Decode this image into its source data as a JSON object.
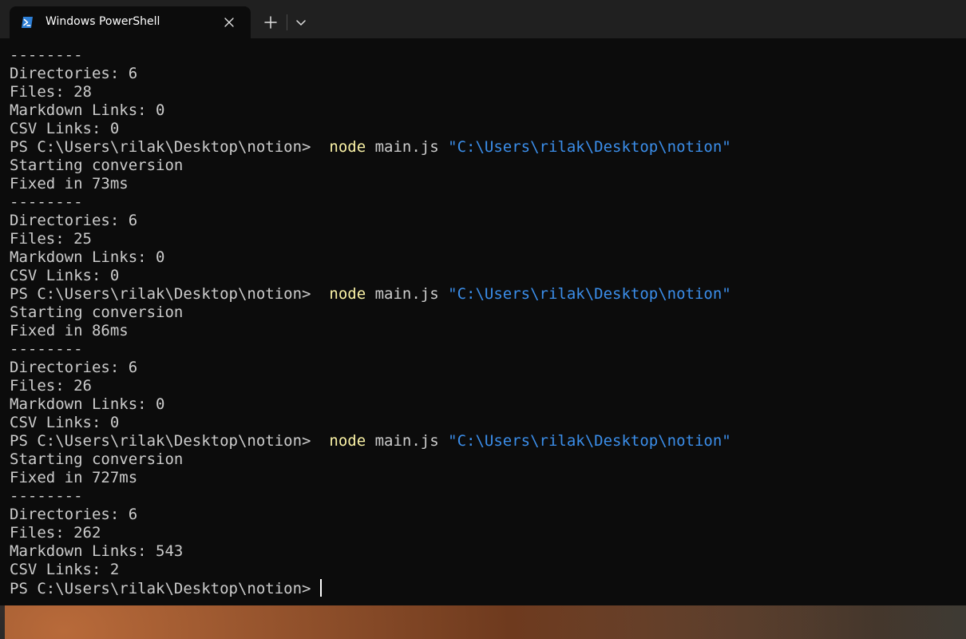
{
  "window": {
    "tab_title": "Windows PowerShell",
    "tab_icon": "powershell-icon",
    "close_icon": "close-icon",
    "new_tab_icon": "plus-icon",
    "dropdown_icon": "chevron-down-icon"
  },
  "terminal": {
    "prompt": "PS C:\\Users\\rilak\\Desktop\\notion>",
    "colors": {
      "background": "#0c0c0c",
      "foreground": "#cccccc",
      "command": "#f9f1a5",
      "string": "#3b8eea"
    },
    "lines": [
      {
        "kind": "text",
        "text": "--------"
      },
      {
        "kind": "text",
        "text": "Directories: 6"
      },
      {
        "kind": "text",
        "text": "Files: 28"
      },
      {
        "kind": "text",
        "text": "Markdown Links: 0"
      },
      {
        "kind": "text",
        "text": "CSV Links: 0"
      },
      {
        "kind": "command",
        "prompt": "PS C:\\Users\\rilak\\Desktop\\notion>",
        "cmd": "node",
        "args": "main.js",
        "str": "\"C:\\Users\\rilak\\Desktop\\notion\""
      },
      {
        "kind": "text",
        "text": "Starting conversion"
      },
      {
        "kind": "text",
        "text": "Fixed in 73ms"
      },
      {
        "kind": "text",
        "text": "--------"
      },
      {
        "kind": "text",
        "text": "Directories: 6"
      },
      {
        "kind": "text",
        "text": "Files: 25"
      },
      {
        "kind": "text",
        "text": "Markdown Links: 0"
      },
      {
        "kind": "text",
        "text": "CSV Links: 0"
      },
      {
        "kind": "command",
        "prompt": "PS C:\\Users\\rilak\\Desktop\\notion>",
        "cmd": "node",
        "args": "main.js",
        "str": "\"C:\\Users\\rilak\\Desktop\\notion\""
      },
      {
        "kind": "text",
        "text": "Starting conversion"
      },
      {
        "kind": "text",
        "text": "Fixed in 86ms"
      },
      {
        "kind": "text",
        "text": "--------"
      },
      {
        "kind": "text",
        "text": "Directories: 6"
      },
      {
        "kind": "text",
        "text": "Files: 26"
      },
      {
        "kind": "text",
        "text": "Markdown Links: 0"
      },
      {
        "kind": "text",
        "text": "CSV Links: 0"
      },
      {
        "kind": "command",
        "prompt": "PS C:\\Users\\rilak\\Desktop\\notion>",
        "cmd": "node",
        "args": "main.js",
        "str": "\"C:\\Users\\rilak\\Desktop\\notion\""
      },
      {
        "kind": "text",
        "text": "Starting conversion"
      },
      {
        "kind": "text",
        "text": "Fixed in 727ms"
      },
      {
        "kind": "text",
        "text": "--------"
      },
      {
        "kind": "text",
        "text": "Directories: 6"
      },
      {
        "kind": "text",
        "text": "Files: 262"
      },
      {
        "kind": "text",
        "text": "Markdown Links: 543"
      },
      {
        "kind": "text",
        "text": "CSV Links: 2"
      },
      {
        "kind": "prompt",
        "prompt": "PS C:\\Users\\rilak\\Desktop\\notion>"
      }
    ]
  }
}
